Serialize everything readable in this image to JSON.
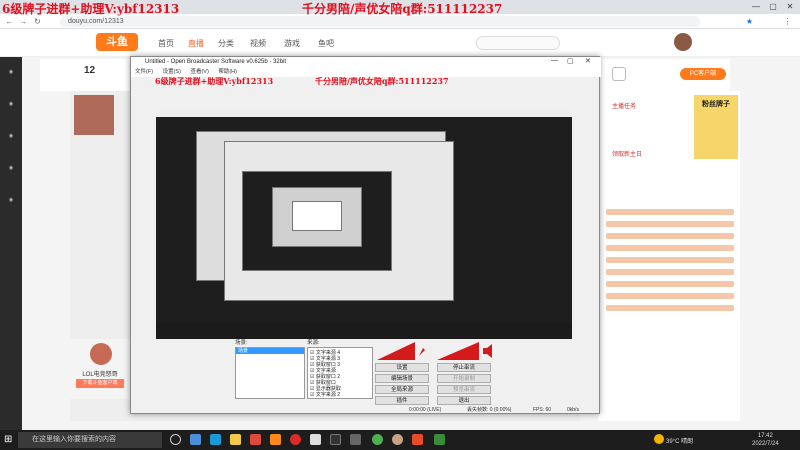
{
  "browser": {
    "url": "douyu.com/12313",
    "window_controls": [
      "—",
      "▢",
      "✕"
    ]
  },
  "overlay_banner": {
    "left": "6级牌子进群+助理V:ybf12313",
    "right": "千分男陪/声优女陪q群:511112237"
  },
  "site": {
    "nav": [
      "首页",
      "直播",
      "分类",
      "视频",
      "游戏",
      "鱼吧"
    ],
    "room_number": "12",
    "anchor_name": "LOL电竞怒哥",
    "follow_button": "下载斗鱼客户端",
    "right_tags": [
      "主播任务",
      "领取新主日"
    ],
    "pc_client": "PC客户端",
    "promo_text": "粉丝牌子"
  },
  "obs": {
    "title": "Untitled - Open Broadcaster Software v0.625b - 32bit",
    "menu": [
      "文件(F)",
      "设置(S)",
      "帮助(H)",
      "查看(V)"
    ],
    "scenes_label": "场景:",
    "sources_label": "来源:",
    "scenes": [
      "场景"
    ],
    "sources": [
      "文字来源 4",
      "文字来源 3",
      "获取窗口 3",
      "文字来源",
      "获取窗口 2",
      "获取窗口",
      "显示器获取",
      "文字来源 2"
    ],
    "buttons": {
      "settings": "设置",
      "stop_stream": "停止串流",
      "edit_scene": "编辑场景",
      "start_record": "开始录制",
      "global_sources": "全局来源",
      "preview": "预览串流",
      "plugins": "插件",
      "exit": "退出"
    },
    "status": {
      "time": "0:00:00 (LIVE)",
      "dropped": "丢失帧数: 0 (0.00%)",
      "fps": "FPS: 60",
      "bitrate": "0kb/s"
    }
  },
  "taskbar": {
    "search_placeholder": "在这里输入你要搜索的内容",
    "weather": "39°C 晴朗",
    "time": "17:42",
    "date": "2022/7/24"
  },
  "colors": {
    "banner_red": "#e0101e",
    "brand_orange": "#ff7a1a"
  }
}
